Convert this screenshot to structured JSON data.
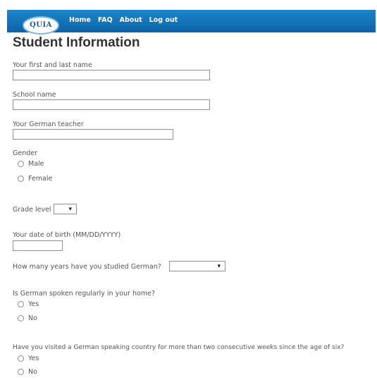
{
  "app": {
    "logo_text": "QUIA"
  },
  "nav": {
    "home": "Home",
    "faq": "FAQ",
    "about": "About",
    "logout": "Log out"
  },
  "page": {
    "title": "Student Information"
  },
  "form": {
    "name_label": "Your first and last name",
    "school_label": "School name",
    "teacher_label": "Your German teacher",
    "gender_label": "Gender",
    "gender_options": [
      "Male",
      "Female"
    ],
    "grade_label": "Grade level",
    "grade_value": "",
    "dob_label": "Your date of birth (MM/DD/YYYY)",
    "years_label": "How many years have you studied German?",
    "years_value": "",
    "home_label": "Is German spoken regularly in your home?",
    "home_options": [
      "Yes",
      "No"
    ],
    "visit_label": "Have you visited a German speaking country for more than two consecutive weeks since the age of six?",
    "visit_options": [
      "Yes",
      "No"
    ]
  },
  "icons": {
    "radio": "radio-button-icon",
    "dropdown": "chevron-down-icon"
  },
  "colors": {
    "header_blue": "#1276bd",
    "text_gray": "#555555"
  }
}
